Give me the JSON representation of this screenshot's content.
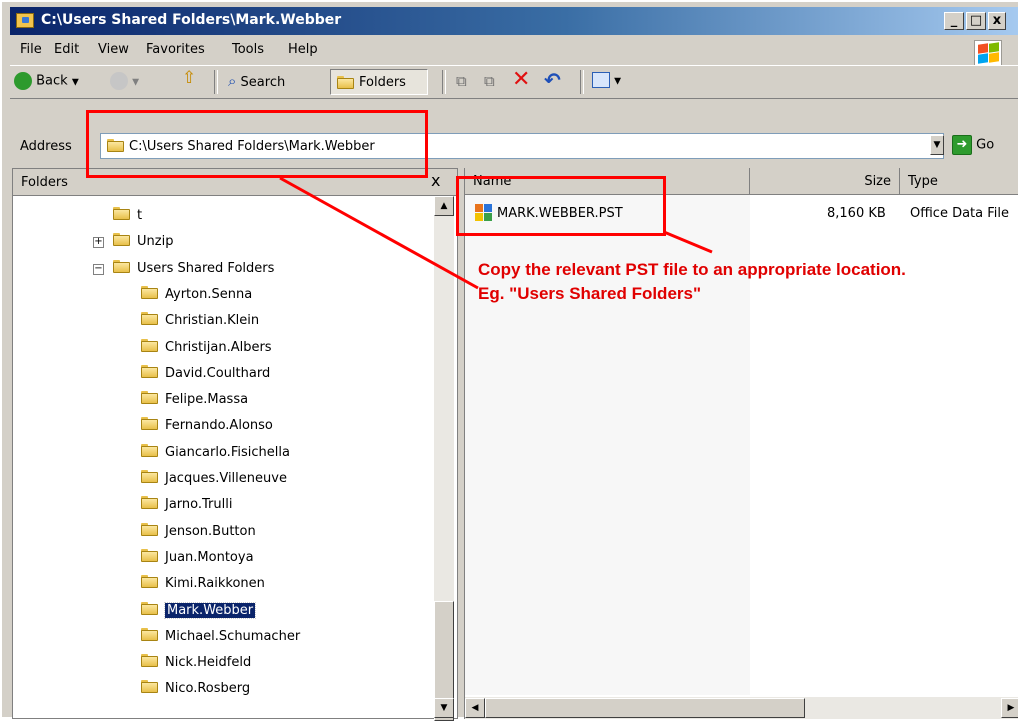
{
  "window": {
    "title": "C:\\Users Shared Folders\\Mark.Webber",
    "caption_buttons": [
      "_",
      "□",
      "x"
    ]
  },
  "menu": [
    {
      "label": "File"
    },
    {
      "label": "Edit"
    },
    {
      "label": "View"
    },
    {
      "label": "Favorites"
    },
    {
      "label": "Tools"
    },
    {
      "label": "Help"
    }
  ],
  "toolbar": {
    "back_label": "Back",
    "search_label": "Search",
    "folders_label": "Folders"
  },
  "address": {
    "label": "Address",
    "value": "C:\\Users Shared Folders\\Mark.Webber",
    "go_label": "Go"
  },
  "folders_pane": {
    "title": "Folders",
    "close_glyph": "x",
    "items": [
      {
        "label": "t",
        "expander": ""
      },
      {
        "label": "Unzip",
        "expander": "+"
      },
      {
        "label": "Users Shared Folders",
        "expander": "−"
      },
      {
        "label": "Ayrton.Senna"
      },
      {
        "label": "Christian.Klein"
      },
      {
        "label": "Christijan.Albers"
      },
      {
        "label": "David.Coulthard"
      },
      {
        "label": "Felipe.Massa"
      },
      {
        "label": "Fernando.Alonso"
      },
      {
        "label": "Giancarlo.Fisichella"
      },
      {
        "label": "Jacques.Villeneuve"
      },
      {
        "label": "Jarno.Trulli"
      },
      {
        "label": "Jenson.Button"
      },
      {
        "label": "Juan.Montoya"
      },
      {
        "label": "Kimi.Raikkonen"
      },
      {
        "label": "Mark.Webber",
        "selected": true
      },
      {
        "label": "Michael.Schumacher"
      },
      {
        "label": "Nick.Heidfeld"
      },
      {
        "label": "Nico.Rosberg"
      }
    ]
  },
  "file_list": {
    "columns": [
      "Name",
      "Size",
      "Type"
    ],
    "rows": [
      {
        "name": "MARK.WEBBER.PST",
        "size": "8,160 KB",
        "type": "Office Data File"
      }
    ]
  },
  "annotation": {
    "line1": "Copy the relevant PST file to an appropriate location.",
    "line2": "Eg. \"Users Shared Folders\"",
    "color": "#ff0000"
  }
}
